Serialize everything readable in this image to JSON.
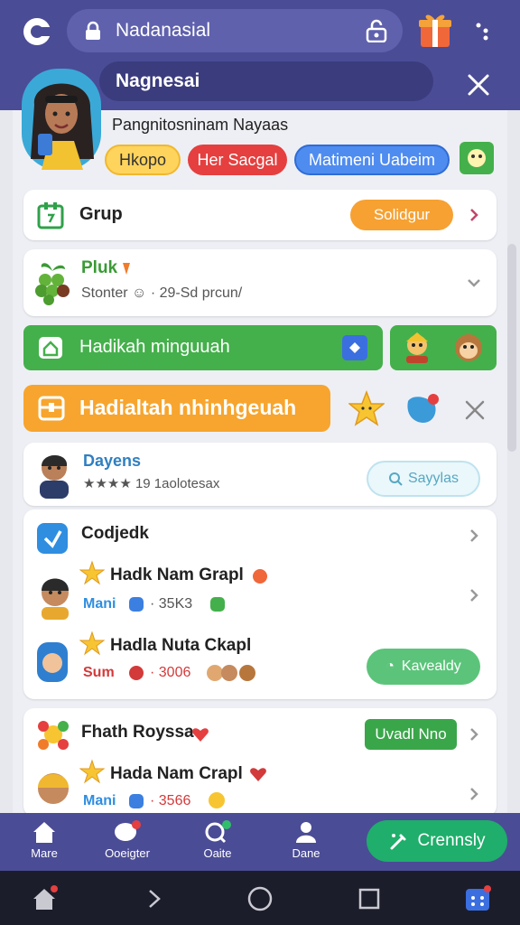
{
  "browser": {
    "url_text": "Nadanasial"
  },
  "profile": {
    "bar_name": "Nagnesai",
    "subtitle": "Pangnitosninam Nayaas",
    "chips": [
      "Hkopo",
      "Her Sacgal",
      "Matimeni Uabeim"
    ]
  },
  "grup_card": {
    "label": "Grup",
    "button": "Solidgur"
  },
  "pluk_card": {
    "title": "Pluk",
    "subtitle": "Stonter ☺ · 29-Sd prcun/"
  },
  "green_bar": {
    "label": "Hadikah minguuah"
  },
  "orange_bar": {
    "label": "Hadialtah nhinhgeuah"
  },
  "dayens": {
    "title": "Dayens",
    "subtitle": "★★★★ 19 1aolotesax",
    "button": "Sayylas"
  },
  "section1": {
    "title": "Codjedk",
    "rows": [
      {
        "name": "Hadk Nam Grapl",
        "sub_left": "Mani",
        "sub_right": "· 35K3"
      },
      {
        "name": "Hadla Nuta Ckapl",
        "sub_left": "Sum",
        "sub_right": "· 3006"
      }
    ],
    "button": "Kavealdy"
  },
  "section2": {
    "title": "Fhath Royssa",
    "button": "Uvadl Nno",
    "rows": [
      {
        "name": "Hada Nam Crapl",
        "sub_left": "Mani",
        "sub_right": "· 3566"
      }
    ]
  },
  "bottom_nav": {
    "items": [
      "Mare",
      "Ooeigter",
      "Oaite",
      "Dane"
    ],
    "fab_label": "Crennsly"
  },
  "colors": {
    "header": "#4b4c96",
    "accent_orange": "#f7a52e",
    "accent_green": "#44b04b",
    "accent_red": "#e53f3f",
    "accent_blue": "#4f8cf0"
  }
}
